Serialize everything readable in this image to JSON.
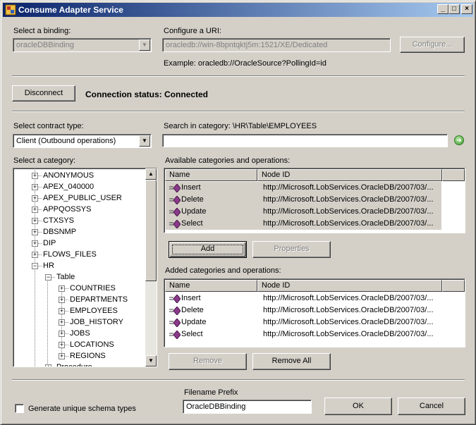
{
  "window": {
    "title": "Consume Adapter Service",
    "minimize": "_",
    "maximize": "□",
    "close": "×"
  },
  "binding": {
    "label": "Select a binding:",
    "value": "oracleDBBinding"
  },
  "uri": {
    "label": "Configure a URI:",
    "value": "oracledb://win-8bpntqktj5m:1521/XE/Dedicated",
    "configure_label": "Configure...",
    "example": "Example: oracledb://OracleSource?PollingId=id"
  },
  "connection": {
    "disconnect_label": "Disconnect",
    "status": "Connection status: Connected"
  },
  "contract": {
    "label": "Select contract type:",
    "value": "Client (Outbound operations)"
  },
  "search": {
    "label": "Search in category: \\HR\\Table\\EMPLOYEES",
    "value": ""
  },
  "category": {
    "label": "Select a category:",
    "items": [
      {
        "label": "ANONYMOUS",
        "expander": "+"
      },
      {
        "label": "APEX_040000",
        "expander": "+"
      },
      {
        "label": "APEX_PUBLIC_USER",
        "expander": "+"
      },
      {
        "label": "APPQOSSYS",
        "expander": "+"
      },
      {
        "label": "CTXSYS",
        "expander": "+"
      },
      {
        "label": "DBSNMP",
        "expander": "+"
      },
      {
        "label": "DIP",
        "expander": "+"
      },
      {
        "label": "FLOWS_FILES",
        "expander": "+"
      },
      {
        "label": "HR",
        "expander": "−"
      },
      {
        "label": "Table",
        "expander": "−"
      },
      {
        "label": "COUNTRIES",
        "expander": "+"
      },
      {
        "label": "DEPARTMENTS",
        "expander": "+"
      },
      {
        "label": "EMPLOYEES",
        "expander": "+"
      },
      {
        "label": "JOB_HISTORY",
        "expander": "+"
      },
      {
        "label": "JOBS",
        "expander": "+"
      },
      {
        "label": "LOCATIONS",
        "expander": "+"
      },
      {
        "label": "REGIONS",
        "expander": "+"
      },
      {
        "label": "Procedure",
        "expander": "+"
      }
    ]
  },
  "available": {
    "label": "Available categories and operations:",
    "columns": [
      "Name",
      "Node ID"
    ],
    "rows": [
      {
        "name": "Insert",
        "node": "http://Microsoft.LobServices.OracleDB/2007/03/..."
      },
      {
        "name": "Delete",
        "node": "http://Microsoft.LobServices.OracleDB/2007/03/..."
      },
      {
        "name": "Update",
        "node": "http://Microsoft.LobServices.OracleDB/2007/03/..."
      },
      {
        "name": "Select",
        "node": "http://Microsoft.LobServices.OracleDB/2007/03/..."
      }
    ],
    "add_label": "Add",
    "properties_label": "Properties"
  },
  "added": {
    "label": "Added categories and operations:",
    "columns": [
      "Name",
      "Node ID"
    ],
    "rows": [
      {
        "name": "Insert",
        "node": "http://Microsoft.LobServices.OracleDB/2007/03/..."
      },
      {
        "name": "Delete",
        "node": "http://Microsoft.LobServices.OracleDB/2007/03/..."
      },
      {
        "name": "Update",
        "node": "http://Microsoft.LobServices.OracleDB/2007/03/..."
      },
      {
        "name": "Select",
        "node": "http://Microsoft.LobServices.OracleDB/2007/03/..."
      }
    ],
    "remove_label": "Remove",
    "remove_all_label": "Remove All"
  },
  "footer": {
    "unique_schema_label": "Generate unique schema types",
    "unique_schema_checked": false,
    "filename_prefix_label": "Filename Prefix",
    "filename_prefix_value": "OracleDBBinding",
    "ok_label": "OK",
    "cancel_label": "Cancel"
  },
  "colors": {
    "titlebar_start": "#0a246a",
    "titlebar_end": "#a6caf0",
    "dialog_face": "#d4d0c8",
    "op_icon": "#8b3a8b"
  }
}
